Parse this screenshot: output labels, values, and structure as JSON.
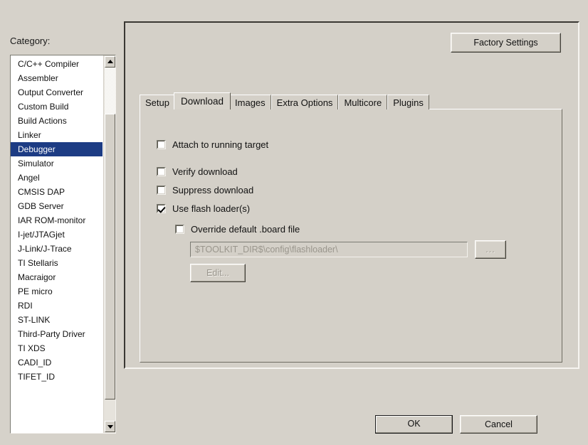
{
  "sidebar": {
    "label": "Category:",
    "items": [
      {
        "label": "C/C++ Compiler",
        "selected": false
      },
      {
        "label": "Assembler",
        "selected": false
      },
      {
        "label": "Output Converter",
        "selected": false
      },
      {
        "label": "Custom Build",
        "selected": false
      },
      {
        "label": "Build Actions",
        "selected": false
      },
      {
        "label": "Linker",
        "selected": false
      },
      {
        "label": "Debugger",
        "selected": true
      },
      {
        "label": "Simulator",
        "selected": false
      },
      {
        "label": "Angel",
        "selected": false
      },
      {
        "label": "CMSIS DAP",
        "selected": false
      },
      {
        "label": "GDB Server",
        "selected": false
      },
      {
        "label": "IAR ROM-monitor",
        "selected": false
      },
      {
        "label": "I-jet/JTAGjet",
        "selected": false
      },
      {
        "label": "J-Link/J-Trace",
        "selected": false
      },
      {
        "label": "TI Stellaris",
        "selected": false
      },
      {
        "label": "Macraigor",
        "selected": false
      },
      {
        "label": "PE micro",
        "selected": false
      },
      {
        "label": "RDI",
        "selected": false
      },
      {
        "label": "ST-LINK",
        "selected": false
      },
      {
        "label": "Third-Party Driver",
        "selected": false
      },
      {
        "label": "TI XDS",
        "selected": false
      },
      {
        "label": "CADI_ID",
        "selected": false
      },
      {
        "label": "TIFET_ID",
        "selected": false
      }
    ],
    "scrollbar": {
      "up_icon": "triangle-up-icon",
      "down_icon": "triangle-down-icon"
    }
  },
  "panel": {
    "factory_settings_label": "Factory Settings",
    "tabs": [
      {
        "label": "Setup",
        "active": false
      },
      {
        "label": "Download",
        "active": true
      },
      {
        "label": "Images",
        "active": false
      },
      {
        "label": "Extra Options",
        "active": false
      },
      {
        "label": "Multicore",
        "active": false
      },
      {
        "label": "Plugins",
        "active": false
      }
    ],
    "download": {
      "attach_to_running_target": {
        "label": "Attach to running target",
        "checked": false
      },
      "verify_download": {
        "label": "Verify download",
        "checked": false
      },
      "suppress_download": {
        "label": "Suppress download",
        "checked": false
      },
      "use_flash_loaders": {
        "label": "Use flash loader(s)",
        "checked": true
      },
      "override_default_board_file": {
        "label": "Override default .board file",
        "checked": false
      },
      "board_file_path": "$TOOLKIT_DIR$\\config\\flashloader\\",
      "browse_label": "...",
      "edit_label": "Edit..."
    }
  },
  "footer": {
    "ok_label": "OK",
    "cancel_label": "Cancel"
  },
  "colors": {
    "background": "#d6d2ca",
    "panel_face": "#d4d0c8",
    "selection": "#1d3c84",
    "list_background": "#ffffff",
    "disabled_text": "#9a968d"
  }
}
